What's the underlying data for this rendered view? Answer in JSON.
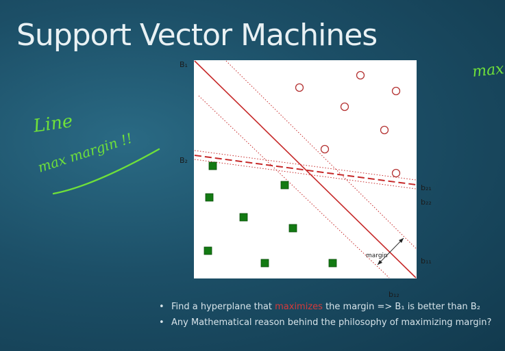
{
  "slide": {
    "title": "Support Vector Machines",
    "bullets": [
      {
        "before": "Find a hyperplane that ",
        "highlight": "maximizes",
        "after": " the margin => B₁ is better than B₂"
      },
      {
        "before": "Any Mathematical reason behind the philosophy of maximizing margin?",
        "highlight": "",
        "after": ""
      }
    ],
    "colors": {
      "highlight": "#d63a3a",
      "ink": "#6fe03a",
      "boundary": "#c62828",
      "square": "#137a13",
      "circle": "#b43232"
    }
  },
  "figure": {
    "labels": {
      "B1": "B₁",
      "B2": "B₂",
      "b21": "b₂₁",
      "b22": "b₂₂",
      "b11": "b₁₁",
      "b12": "b₁₂",
      "margin": "margin"
    }
  },
  "annotations": {
    "handwritten": [
      "Line",
      "max margin !!",
      "max"
    ]
  }
}
